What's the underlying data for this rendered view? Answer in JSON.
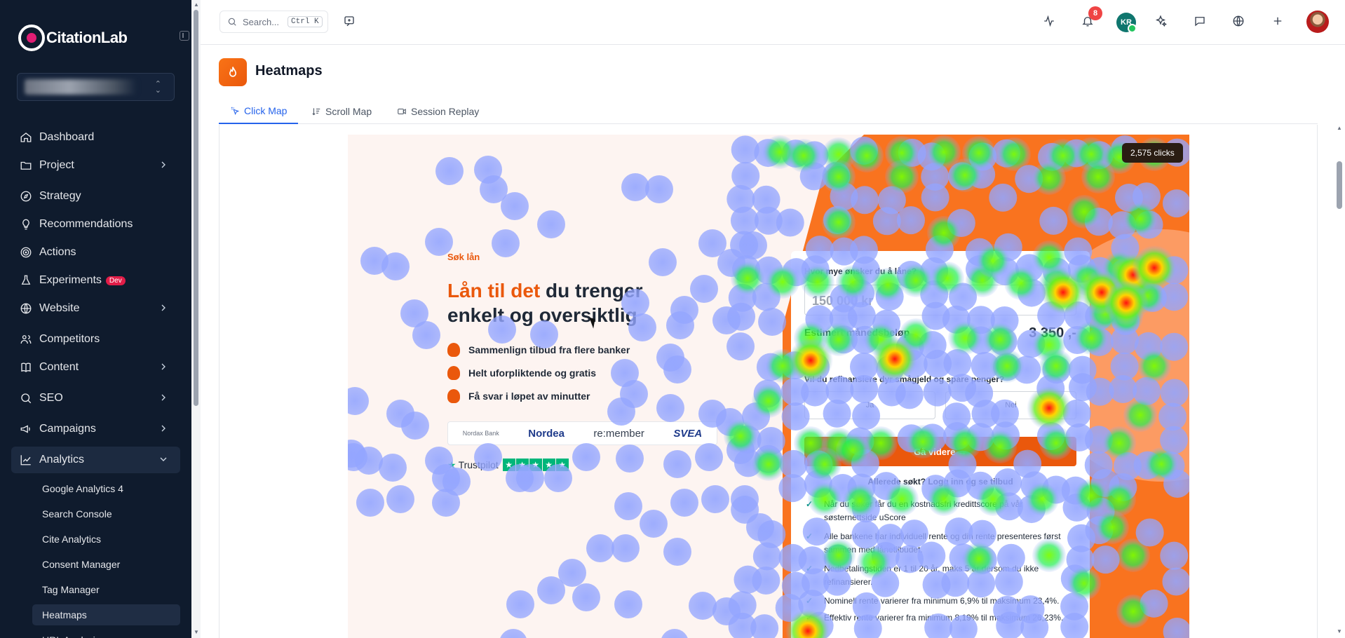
{
  "app": {
    "name": "CitationLab"
  },
  "sidebar": {
    "items": [
      {
        "label": "Dashboard",
        "icon": "home-icon",
        "chevron": false
      },
      {
        "label": "Project",
        "icon": "folder-icon",
        "chevron": true
      },
      {
        "label": "Strategy",
        "icon": "compass-icon",
        "chevron": false
      },
      {
        "label": "Recommendations",
        "icon": "lightbulb-icon",
        "chevron": false
      },
      {
        "label": "Actions",
        "icon": "target-icon",
        "chevron": false
      },
      {
        "label": "Experiments",
        "icon": "flask-icon",
        "chevron": false,
        "badge": "Dev"
      },
      {
        "label": "Website",
        "icon": "globe-icon",
        "chevron": true
      },
      {
        "label": "Competitors",
        "icon": "users-icon",
        "chevron": false
      },
      {
        "label": "Content",
        "icon": "book-icon",
        "chevron": true
      },
      {
        "label": "SEO",
        "icon": "search-icon",
        "chevron": true
      },
      {
        "label": "Campaigns",
        "icon": "megaphone-icon",
        "chevron": true
      },
      {
        "label": "Analytics",
        "icon": "chart-icon",
        "chevron": true,
        "expanded": true
      }
    ],
    "sub_items": [
      {
        "label": "Google Analytics 4"
      },
      {
        "label": "Search Console"
      },
      {
        "label": "Cite Analytics"
      },
      {
        "label": "Consent Manager"
      },
      {
        "label": "Tag Manager"
      },
      {
        "label": "Heatmaps",
        "active": true
      },
      {
        "label": "URL Analysis"
      }
    ]
  },
  "topbar": {
    "search_placeholder": "Search...",
    "search_shortcut": "Ctrl K",
    "notification_count": "8",
    "user_initials": "KR"
  },
  "page": {
    "title": "Heatmaps",
    "tabs": [
      {
        "label": "Click Map",
        "active": true
      },
      {
        "label": "Scroll Map",
        "active": false
      },
      {
        "label": "Session Replay",
        "active": false
      }
    ],
    "clicks_badge": "2,575 clicks"
  },
  "preview": {
    "eyebrow": "Søk lån",
    "title_highlight": "Lån til det",
    "title_rest": " du trenger enkelt og oversiktlig",
    "bullets": [
      "Sammenlign tilbud fra flere banker",
      "Helt uforpliktende og gratis",
      "Få svar i løpet av minutter"
    ],
    "banks": [
      "Nordax Bank",
      "Nordea",
      "re:member",
      "SVEA"
    ],
    "trustpilot": "Trustpilot",
    "form": {
      "amount_label": "Hvor mye ønsker du å låne?",
      "amount_value": "150 000 kr",
      "estimate_label": "Estimert månedsbeløp",
      "estimate_value": "3 350 ,-",
      "refinance_label": "Vil du refinansiere dyr smågjeld og spare penger?",
      "option_yes": "Ja",
      "option_no": "Nei",
      "cta": "Gå videre →",
      "login_link": "Allerede søkt? Logg inn og se tilbud",
      "checks": [
        "Når du søker får du en kostnadsfri kredittscore på vår søsternettside uScore",
        "Alle bankene har individuell rente og din rente presenteres først sammen med lånetilbudet.",
        "Nedbetalingstiden er 1 til 20 år, maks 5 år dersom du ikke refinansierer.",
        "Nominell rente varierer fra minimum 6,9% til maksimum 23,4%.",
        "Effektiv rente varierer fra minimum 8,19% til maksimum 26,23%."
      ]
    }
  },
  "colors": {
    "sidebar_bg": "#0f1b2d",
    "accent": "#2563eb",
    "brand_orange": "#ea580c"
  }
}
